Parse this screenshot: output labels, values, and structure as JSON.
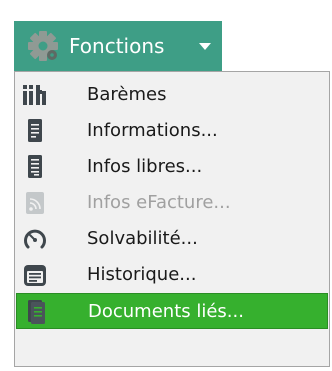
{
  "button": {
    "label": "Fonctions",
    "icon": "gear-icon",
    "caret_icon": "caret-down-icon",
    "color": "#3e9e86"
  },
  "menu": {
    "items": [
      {
        "label": "Barèmes",
        "icon": "scales-icon",
        "enabled": true,
        "selected": false
      },
      {
        "label": "Informations...",
        "icon": "document-icon",
        "enabled": true,
        "selected": false
      },
      {
        "label": "Infos libres...",
        "icon": "document-lines-icon",
        "enabled": true,
        "selected": false
      },
      {
        "label": "Infos eFacture...",
        "icon": "rss-icon",
        "enabled": false,
        "selected": false
      },
      {
        "label": "Solvabilité...",
        "icon": "gauge-icon",
        "enabled": true,
        "selected": false
      },
      {
        "label": "Historique...",
        "icon": "calendar-icon",
        "enabled": true,
        "selected": false
      },
      {
        "label": "Documents liés...",
        "icon": "linked-docs-icon",
        "enabled": true,
        "selected": true
      }
    ],
    "highlight_color": "#36b02e"
  }
}
